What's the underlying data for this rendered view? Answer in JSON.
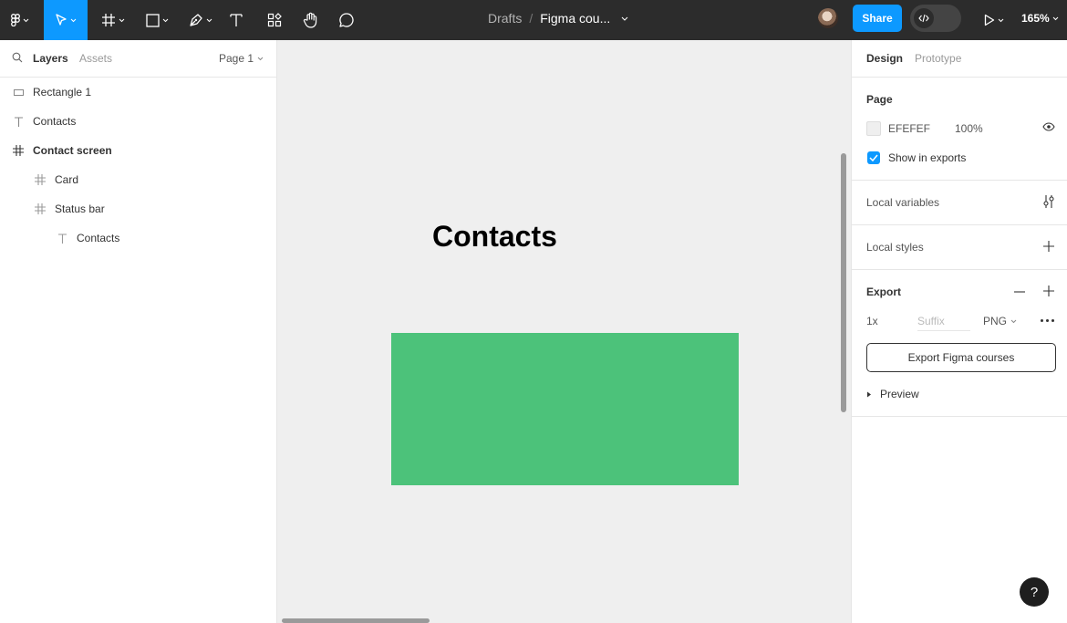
{
  "toolbar": {
    "file_location": "Drafts",
    "separator": "/",
    "file_name": "Figma cou...",
    "share_label": "Share",
    "zoom": "165%"
  },
  "left_panel": {
    "tab_layers": "Layers",
    "tab_assets": "Assets",
    "page_selector": "Page 1",
    "layers": [
      {
        "label": "Rectangle 1",
        "icon": "rectangle-icon"
      },
      {
        "label": "Contacts",
        "icon": "text-icon"
      },
      {
        "label": "Contact screen",
        "icon": "frame-icon"
      },
      {
        "label": "Card",
        "icon": "frame-icon"
      },
      {
        "label": "Status bar",
        "icon": "frame-icon"
      },
      {
        "label": "Contacts",
        "icon": "text-icon"
      }
    ]
  },
  "canvas": {
    "title_text": "Contacts",
    "background": "#EFEFEF",
    "card_color": "#4CC27A"
  },
  "right_panel": {
    "tab_design": "Design",
    "tab_prototype": "Prototype",
    "page_section": "Page",
    "bg_hex": "EFEFEF",
    "bg_opacity": "100%",
    "show_in_exports": "Show in exports",
    "local_variables": "Local variables",
    "local_styles": "Local styles",
    "export_section": "Export",
    "export_scale": "1x",
    "suffix_placeholder": "Suffix",
    "export_format": "PNG",
    "export_button": "Export Figma courses",
    "preview_label": "Preview"
  },
  "help": "?",
  "colors": {
    "accent": "#0D99FF",
    "toolbar_bg": "#2C2C2C",
    "card_green": "#4CC27A"
  }
}
